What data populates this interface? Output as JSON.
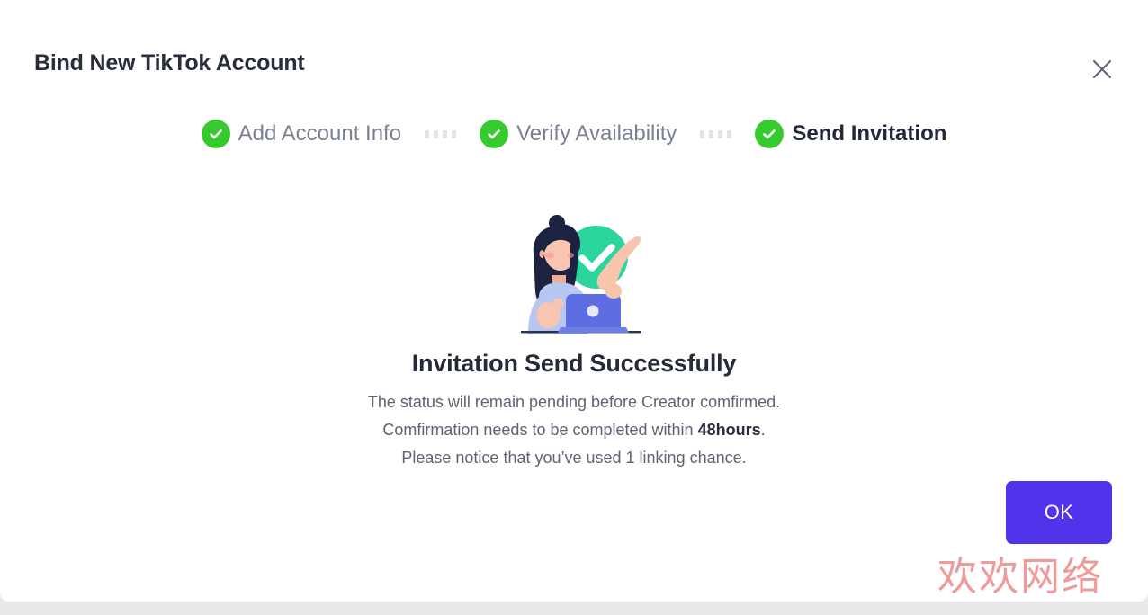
{
  "dialog": {
    "title": "Bind New TikTok Account",
    "close_icon": "close-icon"
  },
  "stepper": {
    "steps": [
      {
        "label": "Add Account Info",
        "state": "completed",
        "icon": "check-circle-icon"
      },
      {
        "label": "Verify Availability",
        "state": "completed",
        "icon": "check-circle-icon"
      },
      {
        "label": "Send Invitation",
        "state": "active",
        "icon": "check-circle-icon"
      }
    ],
    "connector_dot_count": 4,
    "completed_color": "#35cb2f",
    "inactive_label_color": "#7b7f93",
    "active_label_color": "#23273a"
  },
  "content": {
    "illustration_name": "success-person-laptop-illustration",
    "heading": "Invitation Send Successfully",
    "line1": "The status will remain pending before Creator comfirmed.",
    "line2_prefix": "Comfirmation needs to be completed within ",
    "line2_bold": "48hours",
    "line2_suffix": ".",
    "line3": "Please notice that you’ve used 1 linking chance."
  },
  "footer": {
    "ok_label": "OK",
    "ok_color": "#5233ec"
  },
  "watermark": {
    "text": "欢欢网络",
    "color": "#f09b9b"
  }
}
